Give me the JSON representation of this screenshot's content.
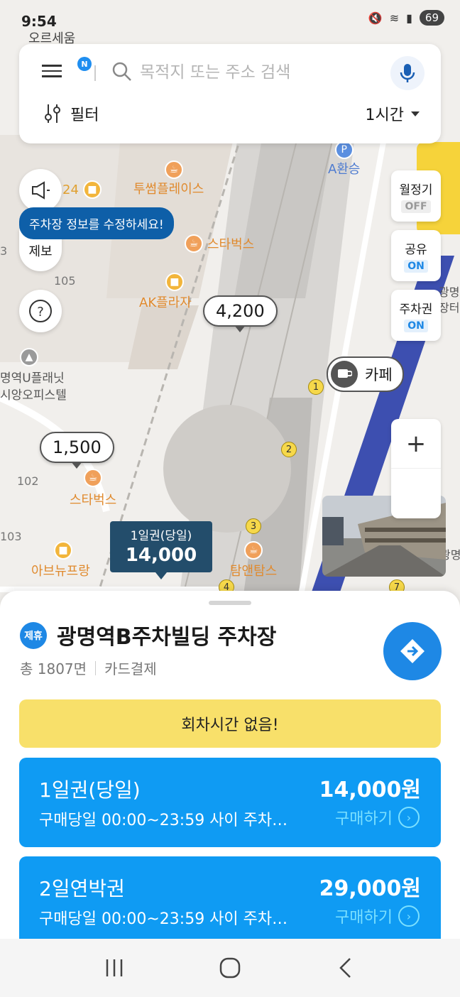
{
  "status_bar": {
    "time": "9:54",
    "battery": "69"
  },
  "search": {
    "menu_badge": "N",
    "placeholder": "목적지 또는 주소 검색",
    "filter_label": "필터",
    "time_option": "1시간"
  },
  "left_controls": {
    "tooltip": "주차장 정보를 수정하세요!",
    "report_label": "제보"
  },
  "right_toggles": [
    {
      "label": "월정기",
      "state": "OFF"
    },
    {
      "label": "공유",
      "state": "ON"
    },
    {
      "label": "주차권",
      "state": "ON"
    }
  ],
  "map": {
    "pois": {
      "twosome": "투썸플레이스",
      "starbucks1": "스타벅스",
      "ak_plaza": "AK플라자",
      "starbucks2": "스타벅스",
      "abenupang": "아브뉴프랑",
      "tamnaen": "탐앤탐스",
      "a_transfer": "A환승",
      "orsewoong": "오르세움",
      "u_planet_1": "명역U플래닛",
      "u_planet_2": "시앙오피스텔",
      "store24": "24",
      "cafe_marker": "카페"
    },
    "building_numbers": [
      "105",
      "102",
      "103",
      "3"
    ],
    "station_exits": [
      "1",
      "2",
      "3",
      "4",
      "7"
    ],
    "price_markers": [
      "4,200",
      "1,500"
    ],
    "selected_marker": {
      "title": "1일권(당일)",
      "price": "14,000"
    },
    "edge_labels": {
      "right_top": "광명",
      "right_mid": "광명",
      "right_mid2": "장터",
      "parking_p": "P"
    }
  },
  "zoom": {
    "plus": "+"
  },
  "sheet": {
    "partner_badge": "제휴",
    "lot_name": "광명역B주차빌딩 주차장",
    "total_spaces": "총 1807면",
    "payment": "카드결제",
    "notice": "회차시간 없음!",
    "tickets": [
      {
        "name": "1일권(당일)",
        "price": "14,000원",
        "desc": "구매당일 00:00~23:59 사이 주차…",
        "buy": "구매하기"
      },
      {
        "name": "2일연박권",
        "price": "29,000원",
        "desc": "구매당일 00:00~23:59 사이 주차…",
        "buy": "구매하기"
      }
    ]
  },
  "icons": {
    "menu": "menu-icon",
    "search": "search-icon",
    "mic": "mic-icon",
    "filter": "filter-icon",
    "speaker": "megaphone-icon",
    "help": "help-icon",
    "navigate": "direction-arrow-icon",
    "recent": "recent-apps-icon",
    "home": "home-icon",
    "back": "back-icon"
  },
  "colors": {
    "accent": "#1e88e5",
    "ticket": "#0f9bf3",
    "notice": "#f8e06a",
    "selected_marker": "#234d6b"
  }
}
